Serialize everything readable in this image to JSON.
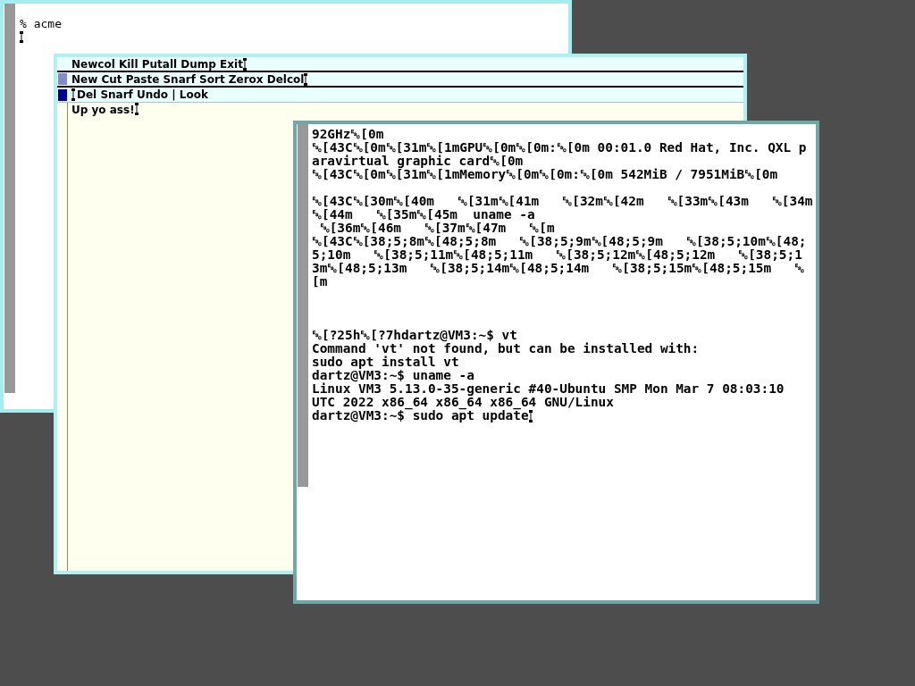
{
  "shell_window": {
    "lines": [
      {
        "text": "% acme"
      }
    ],
    "cursor": true
  },
  "acme_window": {
    "tags": [
      {
        "text": "Newcol Kill Putall Dump Exit",
        "cursor_after": true,
        "cursor_before": false
      },
      {
        "text": "New Cut Paste Snarf Sort Zerox Delcol",
        "cursor_after": true,
        "cursor_before": false,
        "color": "#8888cc"
      },
      {
        "text": "Del Snarf Undo | Look",
        "cursor_after": false,
        "cursor_before": true,
        "color": "#000099"
      }
    ],
    "body": {
      "text": "Up yo ass!",
      "cursor_after": true
    }
  },
  "terminal_window": {
    "lines": [
      {
        "kind": "text",
        "text": "92GHz␛[0m",
        "cursor": false
      },
      {
        "kind": "text",
        "text": "␛[43C␛[0m␛[31m␛[1mGPU␛[0m␛[0m:␛[0m 00:01.0 Red Hat, Inc. QXL p",
        "cursor": false
      },
      {
        "kind": "text",
        "text": "aravirtual graphic card␛[0m",
        "cursor": false
      },
      {
        "kind": "text",
        "text": "␛[43C␛[0m␛[31m␛[1mMemory␛[0m␛[0m:␛[0m 542MiB / 7951MiB␛[0m",
        "cursor": false
      },
      {
        "kind": "blank"
      },
      {
        "kind": "text",
        "text": "␛[43C␛[30m␛[40m   ␛[31m␛[41m   ␛[32m␛[42m   ␛[33m␛[43m   ␛[34m",
        "cursor": false
      },
      {
        "kind": "text",
        "text": "␛[44m   ␛[35m␛[45m  uname -a",
        "cursor": false
      },
      {
        "kind": "text",
        "text": " ␛[36m␛[46m   ␛[37m␛[47m   ␛[m",
        "cursor": false
      },
      {
        "kind": "text",
        "text": "␛[43C␛[38;5;8m␛[48;5;8m   ␛[38;5;9m␛[48;5;9m   ␛[38;5;10m␛[48;",
        "cursor": false
      },
      {
        "kind": "text",
        "text": "5;10m   ␛[38;5;11m␛[48;5;11m   ␛[38;5;12m␛[48;5;12m   ␛[38;5;1",
        "cursor": false
      },
      {
        "kind": "text",
        "text": "3m␛[48;5;13m   ␛[38;5;14m␛[48;5;14m   ␛[38;5;15m␛[48;5;15m   ␛",
        "cursor": false
      },
      {
        "kind": "text",
        "text": "[m",
        "cursor": false
      },
      {
        "kind": "blank"
      },
      {
        "kind": "blank"
      },
      {
        "kind": "blank"
      },
      {
        "kind": "text",
        "text": "␛[?25h␛[?7hdartz@VM3:~$ vt",
        "cursor": false
      },
      {
        "kind": "text",
        "text": "Command 'vt' not found, but can be installed with:",
        "cursor": false
      },
      {
        "kind": "text",
        "text": "sudo apt install vt",
        "cursor": false
      },
      {
        "kind": "text",
        "text": "dartz@VM3:~$ uname -a",
        "cursor": false
      },
      {
        "kind": "text",
        "text": "Linux VM3 5.13.0-35-generic #40-Ubuntu SMP Mon Mar 7 08:03:10",
        "cursor": false
      },
      {
        "kind": "text",
        "text": "UTC 2022 x86_64 x86_64 x86_64 GNU/Linux",
        "cursor": false
      },
      {
        "kind": "text",
        "text": "dartz@VM3:~$ sudo apt update",
        "cursor": true
      }
    ]
  }
}
